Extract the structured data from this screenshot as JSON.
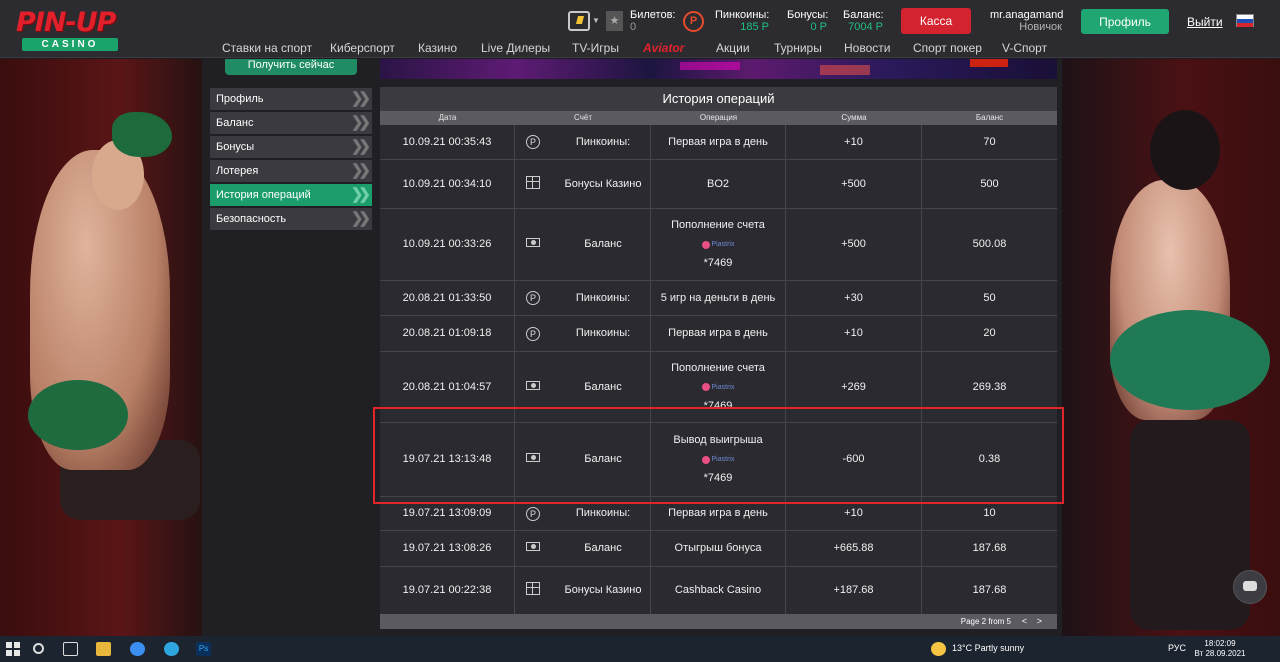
{
  "header": {
    "logo_top": "PIN-UP",
    "logo_bottom": "CASINO",
    "tickets_label": "Билетов:",
    "tickets_value": "0",
    "pincoins_label": "Пинкоины:",
    "pincoins_value": "185 Р",
    "bonuses_label": "Бонусы:",
    "bonuses_value": "0 Р",
    "balance_label": "Баланс:",
    "balance_value": "7004 Р",
    "cashier_button": "Касса",
    "username": "mr.anagamand",
    "user_level": "Новичок",
    "profile_button": "Профиль",
    "logout_link": "Выйти",
    "accent_green": "#1fa672",
    "accent_red": "#d3232e"
  },
  "nav": {
    "items": [
      "Ставки на спорт",
      "Киберспорт",
      "Казино",
      "Live Дилеры",
      "TV-Игры",
      "Aviator",
      "Акции",
      "Турниры",
      "Новости",
      "Спорт покер",
      "V-Спорт"
    ]
  },
  "get_now_button": "Получить сейчас",
  "sidebar": {
    "items": [
      {
        "label": "Профиль"
      },
      {
        "label": "Баланс"
      },
      {
        "label": "Бонусы"
      },
      {
        "label": "Лотерея"
      },
      {
        "label": "История операций"
      },
      {
        "label": "Безопасность"
      }
    ]
  },
  "history": {
    "title": "История операций",
    "columns": [
      "Дата",
      "Счёт",
      "Операция",
      "Сумма",
      "Баланс"
    ],
    "rows": [
      {
        "date": "10.09.21 00:35:43",
        "icon": "pincoin-icon",
        "account": "Пинкоины:",
        "operation": "Первая игра в день",
        "amount": "+10",
        "balance": "70"
      },
      {
        "date": "10.09.21 00:34:10",
        "icon": "gift-icon",
        "account": "Бонусы Казино",
        "operation": "BO2",
        "amount": "+500",
        "balance": "500"
      },
      {
        "date": "10.09.21 00:33:26",
        "icon": "cash-icon",
        "account": "Баланс",
        "operation": "Пополнение счета",
        "payment_system": "Piastrix",
        "card": "*7469",
        "amount": "+500",
        "balance": "500.08"
      },
      {
        "date": "20.08.21 01:33:50",
        "icon": "pincoin-icon",
        "account": "Пинкоины:",
        "operation": "5 игр на деньги в день",
        "amount": "+30",
        "balance": "50"
      },
      {
        "date": "20.08.21 01:09:18",
        "icon": "pincoin-icon",
        "account": "Пинкоины:",
        "operation": "Первая игра в день",
        "amount": "+10",
        "balance": "20"
      },
      {
        "date": "20.08.21 01:04:57",
        "icon": "cash-icon",
        "account": "Баланс",
        "operation": "Пополнение счета",
        "payment_system": "Piastrix",
        "card": "*7469",
        "amount": "+269",
        "balance": "269.38"
      },
      {
        "date": "19.07.21 13:13:48",
        "icon": "cash-icon",
        "account": "Баланс",
        "operation": "Вывод выигрыша",
        "payment_system": "Piastrix",
        "card": "*7469",
        "amount": "-600",
        "balance": "0.38"
      },
      {
        "date": "19.07.21 13:09:09",
        "icon": "pincoin-icon",
        "account": "Пинкоины:",
        "operation": "Первая игра в день",
        "amount": "+10",
        "balance": "10"
      },
      {
        "date": "19.07.21 13:08:26",
        "icon": "cash-icon",
        "account": "Баланс",
        "operation": "Отыгрыш бонуса",
        "amount": "+665.88",
        "balance": "187.68"
      },
      {
        "date": "19.07.21 00:22:38",
        "icon": "gift-icon",
        "account": "Бонусы Казино",
        "operation": "Cashback Casino",
        "amount": "+187.68",
        "balance": "187.68"
      }
    ],
    "pager_text": "Page 2 from 5",
    "pager_prev": "<",
    "pager_next": ">"
  },
  "taskbar": {
    "weather": "13°C  Partly sunny",
    "lang": "РУС",
    "time": "18:02:09",
    "date": "Вт 28.09.2021"
  }
}
